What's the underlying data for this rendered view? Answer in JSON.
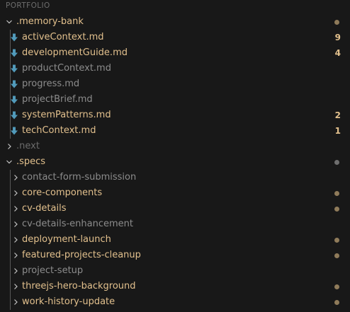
{
  "colors": {
    "background": "#181818",
    "modified": "#e2c08d",
    "muted": "#8c8c8c",
    "ignored": "#6b6b6b",
    "chevron": "#c5c5c5",
    "md_icon": "#519aba",
    "dot": "#8f7b5a",
    "dot_muted": "#6e6e6e"
  },
  "explorer": {
    "section_title": "PORTFOLIO",
    "tree": [
      {
        "kind": "folder",
        "expanded": true,
        "label": ".memory-bank",
        "status": "modified",
        "dot": true,
        "depth": 0
      },
      {
        "kind": "file",
        "icon": "markdown-icon",
        "label": "activeContext.md",
        "status": "modified",
        "badge": "9",
        "depth": 1
      },
      {
        "kind": "file",
        "icon": "markdown-icon",
        "label": "developmentGuide.md",
        "status": "modified",
        "badge": "4",
        "depth": 1
      },
      {
        "kind": "file",
        "icon": "markdown-icon",
        "label": "productContext.md",
        "status": "muted",
        "depth": 1
      },
      {
        "kind": "file",
        "icon": "markdown-icon",
        "label": "progress.md",
        "status": "muted",
        "depth": 1
      },
      {
        "kind": "file",
        "icon": "markdown-icon",
        "label": "projectBrief.md",
        "status": "muted",
        "depth": 1
      },
      {
        "kind": "file",
        "icon": "markdown-icon",
        "label": "systemPatterns.md",
        "status": "modified",
        "badge": "2",
        "depth": 1
      },
      {
        "kind": "file",
        "icon": "markdown-icon",
        "label": "techContext.md",
        "status": "modified",
        "badge": "1",
        "depth": 1
      },
      {
        "kind": "folder",
        "expanded": false,
        "label": ".next",
        "status": "ignored",
        "depth": 0
      },
      {
        "kind": "folder",
        "expanded": true,
        "label": ".specs",
        "status": "modified",
        "dot": true,
        "dotMuted": true,
        "depth": 0
      },
      {
        "kind": "folder",
        "expanded": false,
        "label": "contact-form-submission",
        "status": "muted",
        "depth": 1
      },
      {
        "kind": "folder",
        "expanded": false,
        "label": "core-components",
        "status": "modified",
        "dot": true,
        "depth": 1
      },
      {
        "kind": "folder",
        "expanded": false,
        "label": "cv-details",
        "status": "modified",
        "dot": true,
        "depth": 1
      },
      {
        "kind": "folder",
        "expanded": false,
        "label": "cv-details-enhancement",
        "status": "muted",
        "depth": 1
      },
      {
        "kind": "folder",
        "expanded": false,
        "label": "deployment-launch",
        "status": "modified",
        "dot": true,
        "depth": 1
      },
      {
        "kind": "folder",
        "expanded": false,
        "label": "featured-projects-cleanup",
        "status": "modified",
        "dot": true,
        "depth": 1
      },
      {
        "kind": "folder",
        "expanded": false,
        "label": "project-setup",
        "status": "muted",
        "depth": 1
      },
      {
        "kind": "folder",
        "expanded": false,
        "label": "threejs-hero-background",
        "status": "modified",
        "dot": true,
        "depth": 1
      },
      {
        "kind": "folder",
        "expanded": false,
        "label": "work-history-update",
        "status": "modified",
        "dot": true,
        "depth": 1
      }
    ]
  }
}
